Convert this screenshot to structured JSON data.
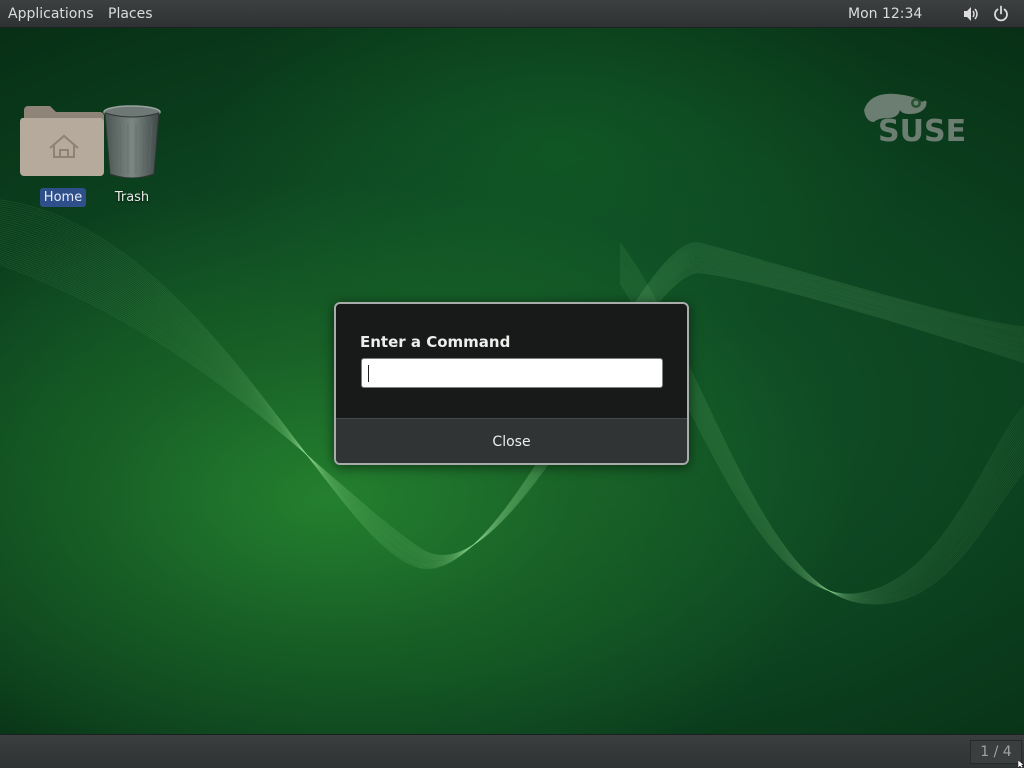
{
  "topbar": {
    "applications_label": "Applications",
    "places_label": "Places",
    "clock": "Mon 12:34",
    "icons": [
      "volume-icon",
      "power-icon"
    ]
  },
  "desktop": {
    "icons": [
      {
        "label": "Home",
        "icon": "home-folder-icon"
      },
      {
        "label": "Trash",
        "icon": "trash-icon"
      }
    ],
    "logo_text": "SUSE"
  },
  "run_dialog": {
    "title": "Enter a Command",
    "input_value": "",
    "close_label": "Close"
  },
  "bottombar": {
    "workspace_indicator": "1 / 4"
  },
  "colors": {
    "desktop_green": "#13582a",
    "panel": "#2e3233",
    "selection_blue": "#2f4f8a",
    "dialog_bg": "#181a1a"
  }
}
